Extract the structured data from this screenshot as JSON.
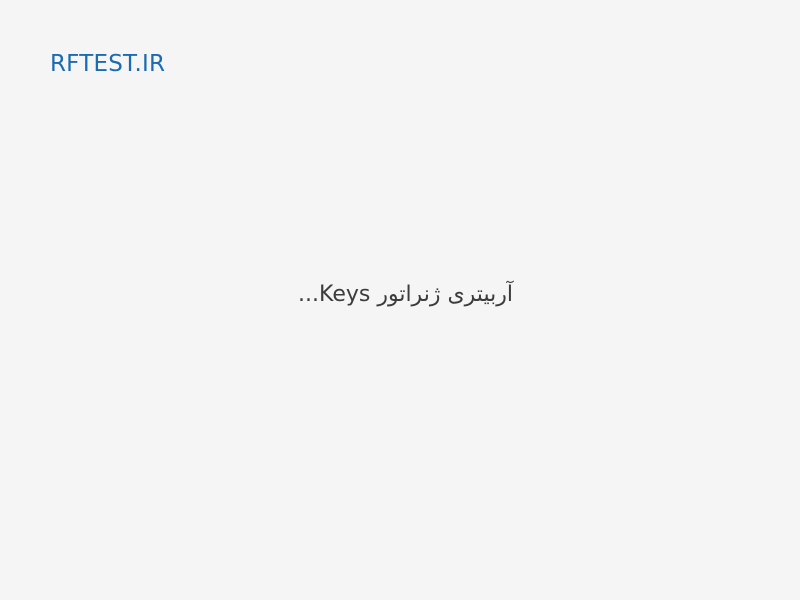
{
  "header": {
    "logo_text": "RFTEST.IR"
  },
  "main": {
    "loading_text": "آربیتری ژنراتور Keys..."
  },
  "colors": {
    "background": "#f5f5f5",
    "logo": "#1a6bb1",
    "text": "#3c3c3c"
  }
}
